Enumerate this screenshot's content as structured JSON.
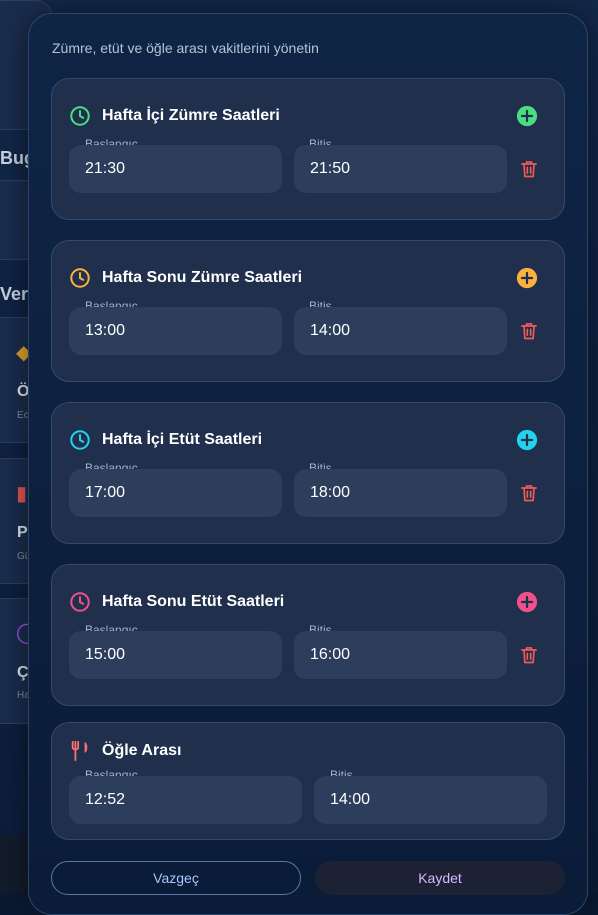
{
  "background": {
    "labels": [
      "Bug",
      "Ver"
    ],
    "letters": [
      "Ö",
      "P",
      "Ç"
    ],
    "subs": [
      "Ec",
      "Gü",
      "Ha"
    ]
  },
  "modal": {
    "subtitle": "Zümre, etüt ve öğle arası vakitlerini yönetin",
    "sections": [
      {
        "title": "Hafta İçi Zümre Saatleri",
        "icon": "clock-icon",
        "accent": "#4ade80",
        "start_label": "Başlangıç",
        "end_label": "Bitiş",
        "start": "21:30",
        "end": "21:50"
      },
      {
        "title": "Hafta Sonu Zümre Saatleri",
        "icon": "clock-icon",
        "accent": "#fbb040",
        "start_label": "Başlangıç",
        "end_label": "Bitiş",
        "start": "13:00",
        "end": "14:00"
      },
      {
        "title": "Hafta İçi Etüt Saatleri",
        "icon": "clock-icon",
        "accent": "#22d3ee",
        "start_label": "Başlangıç",
        "end_label": "Bitiş",
        "start": "17:00",
        "end": "18:00"
      },
      {
        "title": "Hafta Sonu Etüt Saatleri",
        "icon": "clock-icon",
        "accent": "#f0508c",
        "start_label": "Başlangıç",
        "end_label": "Bitiş",
        "start": "15:00",
        "end": "16:00"
      }
    ],
    "lunch": {
      "title": "Öğle Arası",
      "icon": "utensils-icon",
      "accent": "#f87171",
      "start_label": "Başlangıç",
      "end_label": "Bitiş",
      "start": "12:52",
      "end": "14:00"
    },
    "cancel_label": "Vazgeç",
    "save_label": "Kaydet",
    "trash_color": "#f25a5a"
  }
}
